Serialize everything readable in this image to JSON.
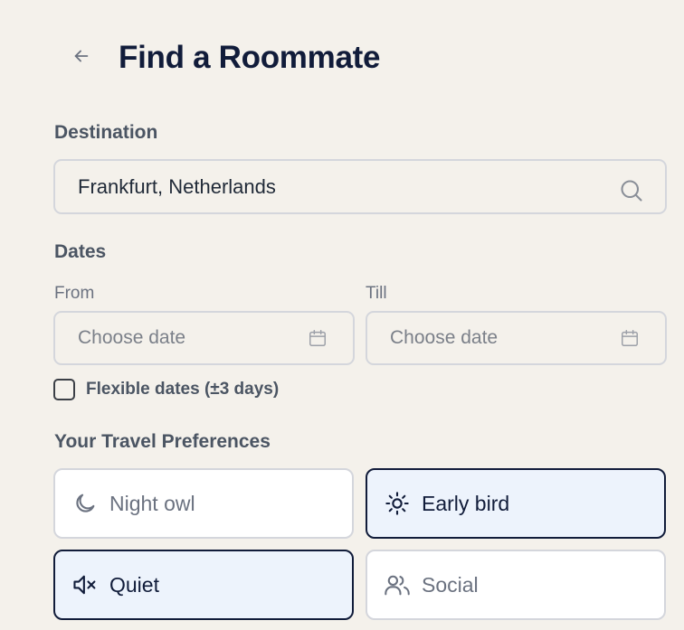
{
  "header": {
    "back_icon": "arrow-left-icon",
    "title": "Find a Roommate"
  },
  "destination": {
    "label": "Destination",
    "value": "Frankfurt, Netherlands",
    "icon": "search-icon"
  },
  "dates": {
    "label": "Dates",
    "from_label": "From",
    "till_label": "Till",
    "from_placeholder": "Choose date",
    "till_placeholder": "Choose date",
    "icon": "calendar-icon",
    "flexible_label": "Flexible dates (±3 days)",
    "flexible_checked": false
  },
  "preferences": {
    "label": "Your Travel Preferences",
    "options": [
      {
        "label": "Night owl",
        "icon": "moon-icon",
        "selected": false
      },
      {
        "label": "Early bird",
        "icon": "sun-icon",
        "selected": true
      },
      {
        "label": "Quiet",
        "icon": "volume-mute-icon",
        "selected": true
      },
      {
        "label": "Social",
        "icon": "users-icon",
        "selected": false
      }
    ]
  },
  "colors": {
    "background": "#f4f1eb",
    "title": "#111c3a",
    "selected_bg": "#edf3fc",
    "selected_border": "#111c3a",
    "field_border": "#d4d6dc"
  }
}
